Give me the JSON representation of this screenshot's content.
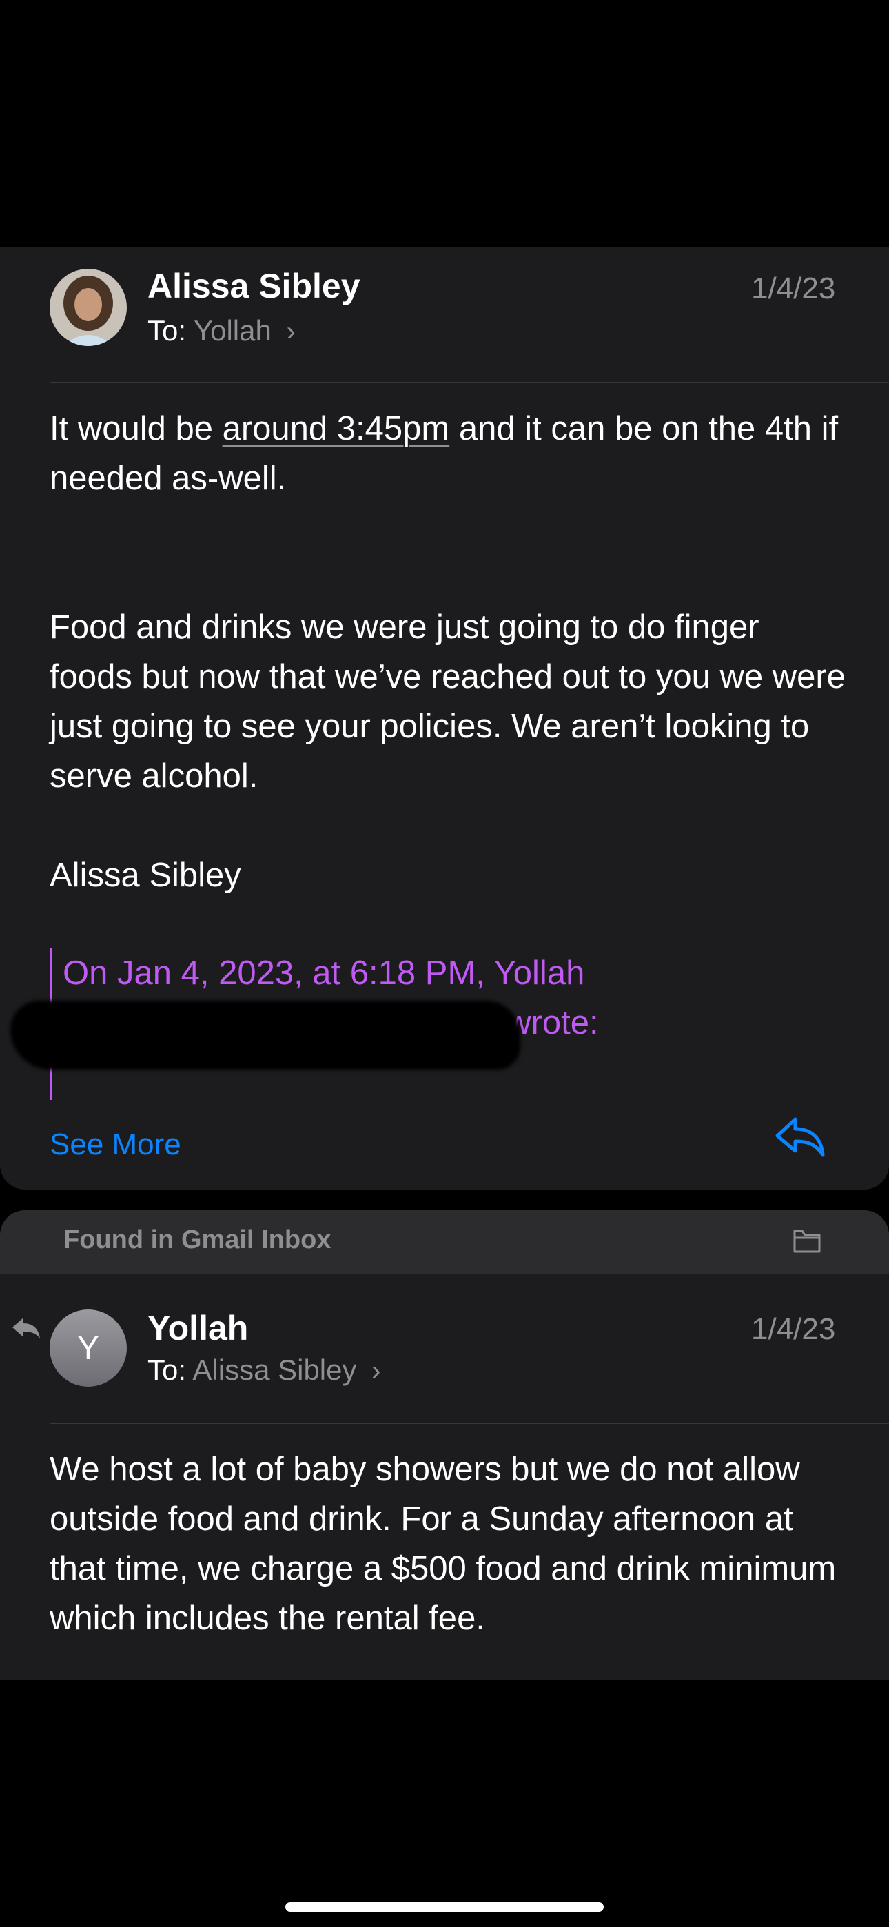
{
  "message1": {
    "sender": "Alissa Sibley",
    "to_label": "To:",
    "to_name": "Yollah",
    "date": "1/4/23",
    "body_line1_pre": "It would be ",
    "body_line1_link": "around 3:45pm",
    "body_line1_post": " and it can be on the 4th if needed as-well.",
    "body_para2": "Food and drinks we were just going to do finger foods but now that we’ve reached out to you we were just going to see your policies. We aren’t looking to serve alcohol.",
    "signature": "Alissa Sibley",
    "quote_line1": "On Jan 4, 2023, at 6:18 PM, Yollah",
    "quote_line2": "> wrote:",
    "see_more": "See More",
    "reply_icon": "reply-arrow-icon"
  },
  "found_bar": {
    "label": "Found in Gmail Inbox",
    "icon": "folder-icon"
  },
  "message2": {
    "avatar_initial": "Y",
    "sender": "Yollah",
    "to_label": "To:",
    "to_name": "Alissa Sibley",
    "date": "1/4/23",
    "body": "We host a lot of baby showers but we do not allow outside food and drink.  For a Sunday afternoon at that time, we charge a $500 food and drink minimum which includes the rental fee."
  },
  "colors": {
    "background": "#000000",
    "card": "#1c1c1e",
    "accent": "#0a84ff",
    "quote": "#bf5af2",
    "secondary_text": "#8e8e93"
  }
}
